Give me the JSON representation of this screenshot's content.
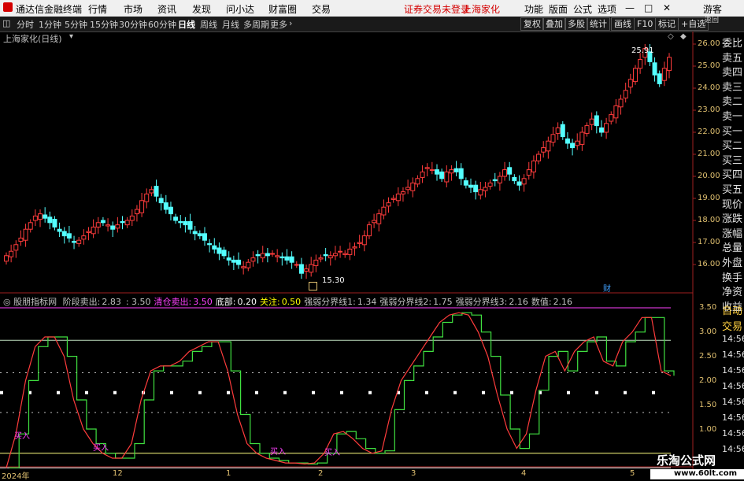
{
  "menubar": {
    "app_title": "通达信金融终端",
    "menus": [
      "行情",
      "市场",
      "资讯",
      "发现",
      "问小达",
      "财富圈",
      "交易"
    ],
    "status": "证券交易未登录",
    "stock": "上海家化",
    "right_menus": [
      "功能",
      "版面",
      "公式",
      "选项"
    ],
    "guest": "游客",
    "win_controls": [
      "—",
      "□",
      "✕"
    ]
  },
  "toolbar": {
    "periods": [
      "分时",
      "1分钟",
      "5分钟",
      "15分钟",
      "30分钟",
      "60分钟",
      "日线",
      "周线",
      "月线",
      "多周期",
      "更多"
    ],
    "active_period": "日线",
    "right_buttons": [
      "复权",
      "叠加",
      "多股",
      "统计",
      "画线",
      "F10",
      "标记",
      "+自选"
    ],
    "back_label": "返回"
  },
  "chart_title": "上海家化(日线)",
  "price_axis": {
    "ticks": [
      "26.00",
      "25.00",
      "24.00",
      "23.00",
      "22.00",
      "21.00",
      "20.00",
      "19.00",
      "18.00",
      "17.00",
      "16.00"
    ]
  },
  "annotations": {
    "high": "25.91",
    "low": "15.30",
    "cai": "财"
  },
  "right_panel": [
    "委比",
    "卖五",
    "卖四",
    "卖三",
    "卖二",
    "卖一",
    "买一",
    "买二",
    "买三",
    "买四",
    "买五",
    "现价",
    "涨跌",
    "涨幅",
    "总量",
    "外盘",
    "换手",
    "净资",
    "收益"
  ],
  "sub_right_panel": [
    "自动",
    "交易",
    "14:56",
    "14:56",
    "14:56",
    "14:56",
    "14:56",
    "14:56",
    "14:56",
    "14:56"
  ],
  "indicator": {
    "name": "股朋指标网",
    "items": [
      {
        "label": "阶段卖出:",
        "value": "2.83",
        "color": "#c0c0c0"
      },
      {
        "label": "",
        "value": ": 3.50",
        "color": "#c0c0c0"
      },
      {
        "label": "清仓卖出:",
        "value": "3.50",
        "color": "#ff40ff"
      },
      {
        "label": "底部:",
        "value": "0.20",
        "color": "#ffffff"
      },
      {
        "label": "关注:",
        "value": "0.50",
        "color": "#ffff00"
      },
      {
        "label": "强弱分界线1:",
        "value": "1.34",
        "color": "#c0c0c0"
      },
      {
        "label": "强弱分界线2:",
        "value": "1.75",
        "color": "#c0c0c0"
      },
      {
        "label": "强弱分界线3:",
        "value": "2.16",
        "color": "#c0c0c0"
      },
      {
        "label": "数值:",
        "value": "2.16",
        "color": "#c0c0c0"
      }
    ],
    "buy_label": "买入",
    "axis": [
      "3.50",
      "3.00",
      "2.50",
      "2.00",
      "1.50",
      "1.00"
    ]
  },
  "time_axis": [
    "2024年",
    "12",
    "1",
    "2",
    "3",
    "4",
    "5"
  ],
  "watermark": {
    "title": "乐淘公式网",
    "url": "www.60lt.com"
  },
  "colors": {
    "up": "#ff3c3c",
    "down": "#54ffff",
    "green_line": "#40e040"
  }
}
